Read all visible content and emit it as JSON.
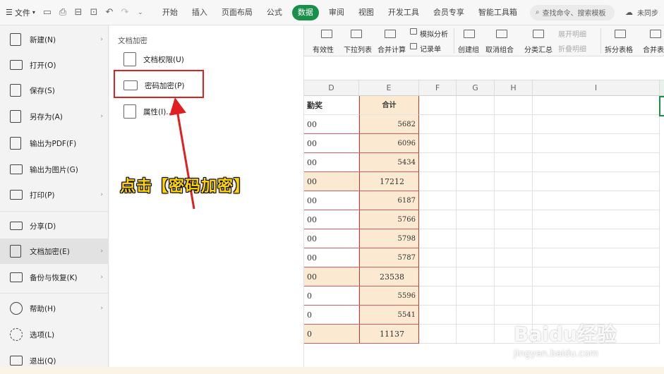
{
  "topbar": {
    "file_label": "文件",
    "tabs": [
      "开始",
      "插入",
      "页面布局",
      "公式",
      "数据",
      "审阅",
      "视图",
      "开发工具",
      "会员专享",
      "智能工具箱"
    ],
    "active_tab": "数据",
    "search_placeholder": "查找命令、搜索模板",
    "user_label": "未同步"
  },
  "ribbon": {
    "items": [
      "有效性",
      "下拉列表",
      "合并计算",
      "记录单",
      "创建组",
      "取消组合",
      "分类汇总",
      "展开明细",
      "折叠明细",
      "拆分表格",
      "合并表格",
      "模拟分析"
    ]
  },
  "grid": {
    "columns": [
      "D",
      "E",
      "F",
      "G",
      "H",
      "I"
    ],
    "header_row": {
      "d": "勤奖",
      "e": "合计"
    },
    "rows": [
      {
        "d": "00",
        "e": "5682",
        "total": false
      },
      {
        "d": "00",
        "e": "6096",
        "total": false
      },
      {
        "d": "00",
        "e": "5434",
        "total": false
      },
      {
        "d": "00",
        "e": "17212",
        "total": true
      },
      {
        "d": "00",
        "e": "6187",
        "total": false
      },
      {
        "d": "00",
        "e": "5766",
        "total": false
      },
      {
        "d": "00",
        "e": "5798",
        "total": false
      },
      {
        "d": "00",
        "e": "5787",
        "total": false
      },
      {
        "d": "00",
        "e": "23538",
        "total": true
      },
      {
        "d": "0",
        "e": "5596",
        "total": false
      },
      {
        "d": "0",
        "e": "5541",
        "total": false
      },
      {
        "d": "0",
        "e": "11137",
        "total": true
      }
    ]
  },
  "filemenu": {
    "items": [
      {
        "label": "新建(N)",
        "arrow": true
      },
      {
        "label": "打开(O)",
        "arrow": false
      },
      {
        "label": "保存(S)",
        "arrow": false
      },
      {
        "label": "另存为(A)",
        "arrow": true
      },
      {
        "label": "输出为PDF(F)",
        "arrow": false
      },
      {
        "label": "输出为图片(G)",
        "arrow": false
      },
      {
        "label": "打印(P)",
        "arrow": true
      },
      {
        "label": "分享(D)",
        "arrow": false
      },
      {
        "label": "文档加密(E)",
        "arrow": true
      },
      {
        "label": "备份与恢复(K)",
        "arrow": true
      },
      {
        "label": "帮助(H)",
        "arrow": true
      },
      {
        "label": "选项(L)",
        "arrow": false
      },
      {
        "label": "退出(Q)",
        "arrow": false
      }
    ]
  },
  "submenu": {
    "title": "文档加密",
    "items": [
      "文档权限(U)",
      "密码加密(P)",
      "属性(I)..."
    ]
  },
  "annotation": "点击【密码加密】",
  "watermark": {
    "logo": "Baidu经验",
    "url": "jingyan.baidu.com"
  },
  "colors": {
    "accent": "#1a8f4a",
    "highlight_red": "#e02020",
    "annotation_yellow": "#ffd400",
    "cell_fill": "#fbe9d1"
  }
}
